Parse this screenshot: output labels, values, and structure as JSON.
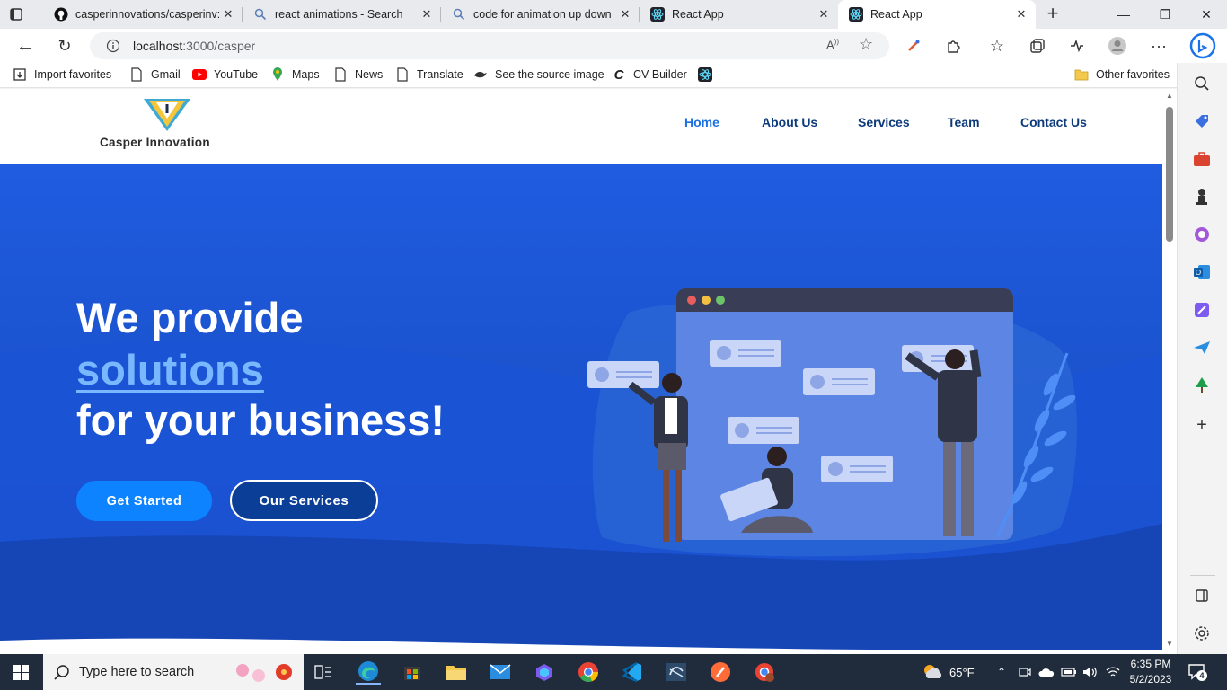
{
  "browser": {
    "tabs": [
      {
        "title": "casperinnovations/casperinv:",
        "icon": "github-icon",
        "active": false
      },
      {
        "title": "react animations - Search",
        "icon": "search-icon",
        "active": false
      },
      {
        "title": "code for animation up down",
        "icon": "search-icon",
        "active": false
      },
      {
        "title": "React App",
        "icon": "react-icon",
        "active": false
      },
      {
        "title": "React App",
        "icon": "react-icon",
        "active": true
      }
    ],
    "address": {
      "host": "localhost",
      "path": ":3000/casper"
    },
    "favorites": [
      {
        "label": "Import favorites",
        "icon": "import-icon"
      },
      {
        "label": "Gmail",
        "icon": "page-icon"
      },
      {
        "label": "YouTube",
        "icon": "youtube-icon"
      },
      {
        "label": "Maps",
        "icon": "maps-pin-icon"
      },
      {
        "label": "News",
        "icon": "page-icon"
      },
      {
        "label": "Translate",
        "icon": "page-icon"
      },
      {
        "label": "See the source image",
        "icon": "bird-icon"
      },
      {
        "label": "CV Builder",
        "icon": "cv-icon"
      },
      {
        "label": "",
        "icon": "react-icon"
      }
    ],
    "other_favorites": "Other favorites"
  },
  "site": {
    "brand": "Casper Innovation",
    "nav": [
      "Home",
      "About Us",
      "Services",
      "Team",
      "Contact Us"
    ],
    "hero": {
      "line1": "We provide",
      "highlight": "solutions",
      "line3": "for your business!",
      "cta_primary": "Get Started",
      "cta_secondary": "Our Services"
    }
  },
  "taskbar": {
    "search_placeholder": "Type here to search",
    "weather": "65°F",
    "time": "6:35 PM",
    "date": "5/2/2023",
    "notifications": "4"
  },
  "colors": {
    "hero_bg": "#1f5ce0",
    "accent": "#0d83ff",
    "nav_text": "#0d3a7a",
    "highlight": "#79b7ff"
  }
}
